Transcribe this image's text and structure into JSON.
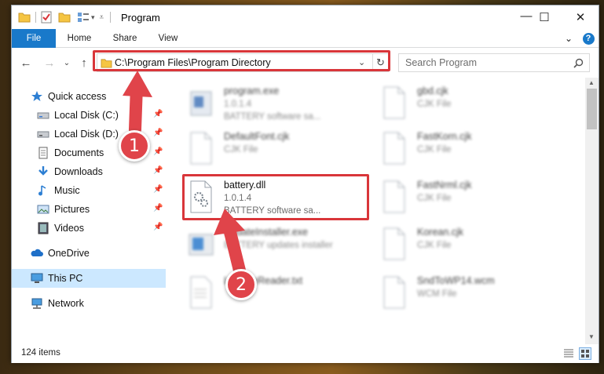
{
  "window": {
    "title": "Program"
  },
  "window_controls": {
    "minimize": "—",
    "maximize": "☐",
    "close": "✕"
  },
  "ribbon": {
    "tabs": [
      {
        "label": "File"
      },
      {
        "label": "Home"
      },
      {
        "label": "Share"
      },
      {
        "label": "View"
      }
    ],
    "expand": "⌄",
    "help": "?"
  },
  "address": {
    "path": "C:\\Program Files\\Program Directory"
  },
  "search": {
    "placeholder": "Search Program"
  },
  "nav": {
    "items": [
      {
        "label": "Quick access",
        "icon": "star-icon"
      },
      {
        "label": "Local Disk (C:)",
        "icon": "drive-icon"
      },
      {
        "label": "Local Disk (D:)",
        "icon": "drive-icon"
      },
      {
        "label": "Documents",
        "icon": "documents-icon"
      },
      {
        "label": "Downloads",
        "icon": "download-icon"
      },
      {
        "label": "Music",
        "icon": "music-icon"
      },
      {
        "label": "Pictures",
        "icon": "pictures-icon"
      },
      {
        "label": "Videos",
        "icon": "videos-icon"
      },
      {
        "label": "OneDrive",
        "icon": "cloud-icon"
      },
      {
        "label": "This PC",
        "icon": "computer-icon"
      },
      {
        "label": "Network",
        "icon": "network-icon"
      }
    ]
  },
  "files": {
    "left": [
      {
        "name": "program.exe",
        "line2": "1.0.1.4",
        "line3": "BATTERY software sa..."
      },
      {
        "name": "DefaultFont.cjk",
        "line2": "CJK File",
        "line3": ""
      },
      {
        "name": "battery.dll",
        "line2": "1.0.1.4",
        "line3": "BATTERY software sa..."
      },
      {
        "name": "UpdateInstaller.exe",
        "line2": "BATTERY updates installer",
        "line3": ""
      },
      {
        "name": "LicenseReader.txt",
        "line2": "",
        "line3": ""
      }
    ],
    "right": [
      {
        "name": "gbd.cjk",
        "line2": "CJK File"
      },
      {
        "name": "FastKorn.cjk",
        "line2": "CJK File"
      },
      {
        "name": "FastNrml.cjk",
        "line2": "CJK File"
      },
      {
        "name": "Korean.cjk",
        "line2": "CJK File"
      },
      {
        "name": "SndToWP14.wcm",
        "line2": "WCM File"
      }
    ]
  },
  "status": {
    "items_count": "124 items"
  },
  "annotations": {
    "step1": "1",
    "step2": "2",
    "color": "#d9363a"
  }
}
